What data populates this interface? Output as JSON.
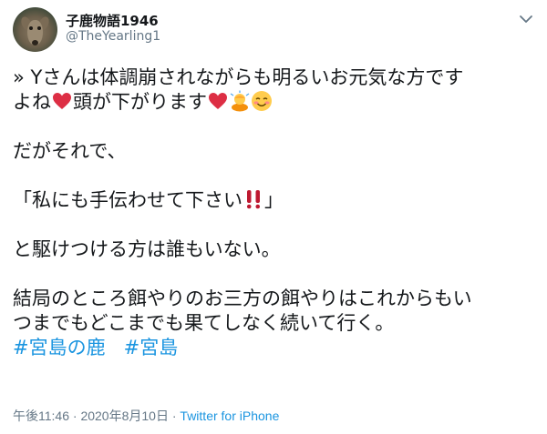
{
  "author": {
    "display_name": "子鹿物語1946",
    "handle": "@TheYearling1"
  },
  "tweet": {
    "line1a": "» Yさんは体調崩されながらも明るいお元気な方です",
    "line1b_pre": "よね",
    "line1b_mid": "頭が下がります",
    "line2": "だがそれで、",
    "line3_pre": "「私にも手伝わせて下さい",
    "line3_post": "」",
    "line4": "と駆けつける方は誰もいない。",
    "line5a": "結局のところ餌やりのお三方の餌やりはこれからもい",
    "line5b": "つまでもどこまでも果てしなく続いて行く。",
    "hashtag1": "#宮島の鹿",
    "hashtag2": "#宮島"
  },
  "meta": {
    "time": "午後11:46",
    "separator1": " · ",
    "date": "2020年8月10日",
    "separator2": " · ",
    "source": "Twitter for iPhone"
  },
  "colors": {
    "text": "#14171a",
    "secondary": "#657786",
    "link": "#1b95e0",
    "heart": "#dd2e44"
  },
  "icons": [
    "chevron-down-icon",
    "red-heart-emoji",
    "person-bowing-emoji",
    "smiling-face-emoji",
    "double-exclamation-emoji"
  ]
}
